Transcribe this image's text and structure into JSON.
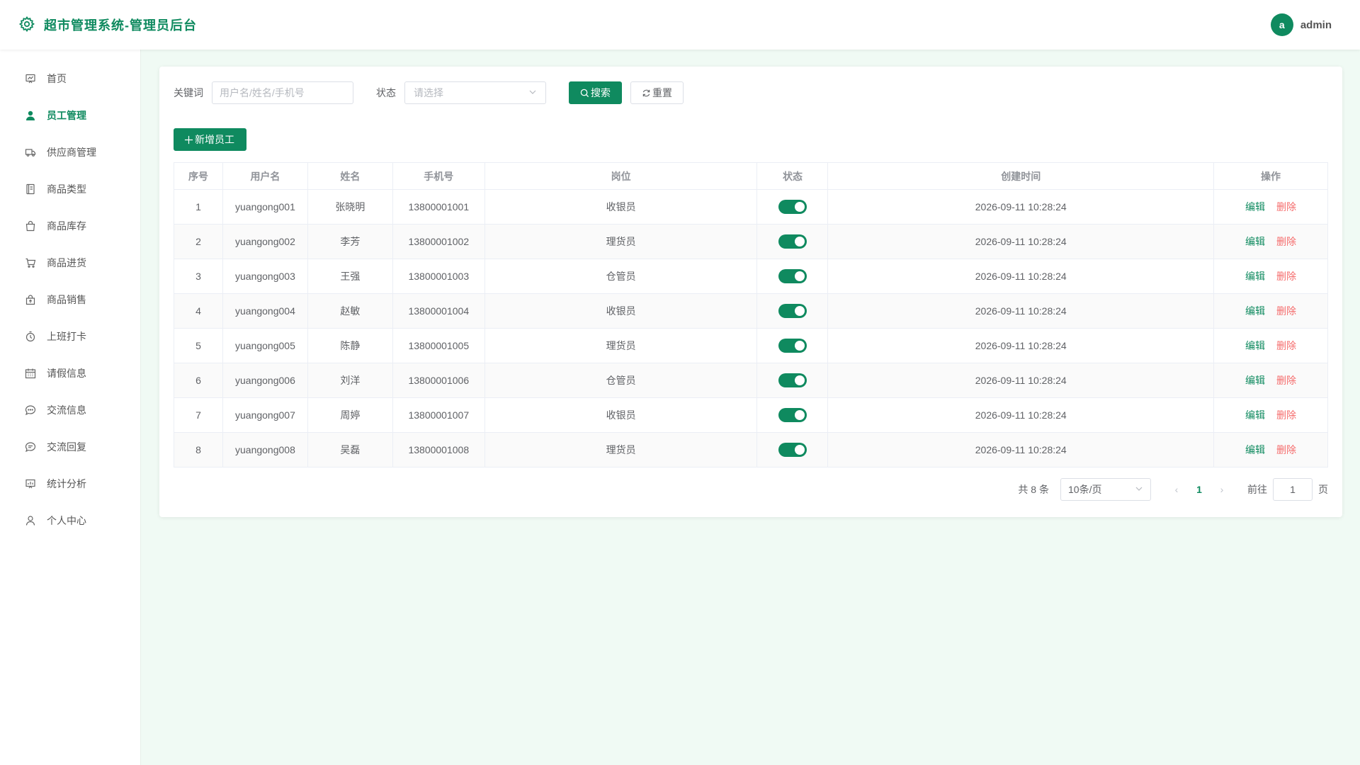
{
  "header": {
    "title": "超市管理系统-管理员后台",
    "avatar_letter": "a",
    "username": "admin",
    "brand_color": "#0f8a5f"
  },
  "sidebar": {
    "items": [
      {
        "label": "首页",
        "icon": "chart-board-icon",
        "active": false
      },
      {
        "label": "员工管理",
        "icon": "user-filled-icon",
        "active": true
      },
      {
        "label": "供应商管理",
        "icon": "truck-icon",
        "active": false
      },
      {
        "label": "商品类型",
        "icon": "notebook-icon",
        "active": false
      },
      {
        "label": "商品库存",
        "icon": "shopping-bag-icon",
        "active": false
      },
      {
        "label": "商品进货",
        "icon": "shopping-cart-icon",
        "active": false
      },
      {
        "label": "商品销售",
        "icon": "sell-icon",
        "active": false
      },
      {
        "label": "上班打卡",
        "icon": "stopwatch-icon",
        "active": false
      },
      {
        "label": "请假信息",
        "icon": "calendar-icon",
        "active": false
      },
      {
        "label": "交流信息",
        "icon": "chat-dots-icon",
        "active": false
      },
      {
        "label": "交流回复",
        "icon": "chat-line-icon",
        "active": false
      },
      {
        "label": "统计分析",
        "icon": "data-board-icon",
        "active": false
      },
      {
        "label": "个人中心",
        "icon": "user-icon",
        "active": false
      }
    ]
  },
  "filter": {
    "keyword_label": "关键词",
    "keyword_placeholder": "用户名/姓名/手机号",
    "status_label": "状态",
    "status_placeholder": "请选择",
    "search_label": "搜索",
    "reset_label": "重置"
  },
  "toolbar": {
    "add_label": "新增员工"
  },
  "table": {
    "columns": [
      "序号",
      "用户名",
      "姓名",
      "手机号",
      "岗位",
      "状态",
      "创建时间",
      "操作"
    ],
    "edit_label": "编辑",
    "delete_label": "删除",
    "rows": [
      {
        "no": "1",
        "username": "yuangong001",
        "name": "张晓明",
        "phone": "13800001001",
        "post": "收银员",
        "enabled": true,
        "created": "2026-09-11 10:28:24"
      },
      {
        "no": "2",
        "username": "yuangong002",
        "name": "李芳",
        "phone": "13800001002",
        "post": "理货员",
        "enabled": true,
        "created": "2026-09-11 10:28:24"
      },
      {
        "no": "3",
        "username": "yuangong003",
        "name": "王强",
        "phone": "13800001003",
        "post": "仓管员",
        "enabled": true,
        "created": "2026-09-11 10:28:24"
      },
      {
        "no": "4",
        "username": "yuangong004",
        "name": "赵敏",
        "phone": "13800001004",
        "post": "收银员",
        "enabled": true,
        "created": "2026-09-11 10:28:24"
      },
      {
        "no": "5",
        "username": "yuangong005",
        "name": "陈静",
        "phone": "13800001005",
        "post": "理货员",
        "enabled": true,
        "created": "2026-09-11 10:28:24"
      },
      {
        "no": "6",
        "username": "yuangong006",
        "name": "刘洋",
        "phone": "13800001006",
        "post": "仓管员",
        "enabled": true,
        "created": "2026-09-11 10:28:24"
      },
      {
        "no": "7",
        "username": "yuangong007",
        "name": "周婷",
        "phone": "13800001007",
        "post": "收银员",
        "enabled": true,
        "created": "2026-09-11 10:28:24"
      },
      {
        "no": "8",
        "username": "yuangong008",
        "name": "吴磊",
        "phone": "13800001008",
        "post": "理货员",
        "enabled": true,
        "created": "2026-09-11 10:28:24"
      }
    ]
  },
  "pagination": {
    "total_text": "共 8 条",
    "page_size": "10条/页",
    "current_page": "1",
    "goto_label": "前往",
    "goto_value": "1",
    "page_suffix": "页"
  }
}
